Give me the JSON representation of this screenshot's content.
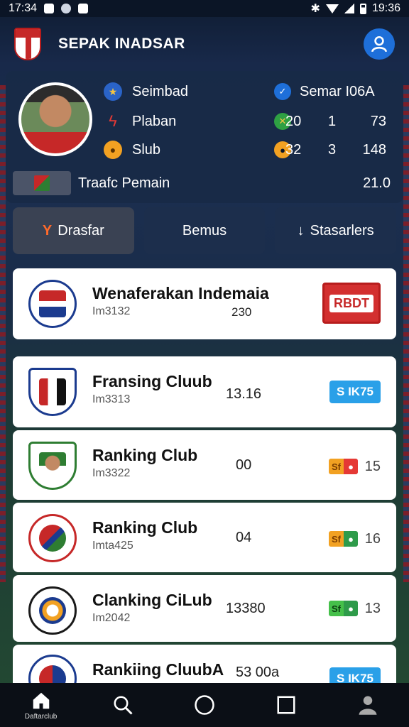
{
  "status_bar": {
    "time_left": "17:34",
    "time_right": "19:36"
  },
  "header": {
    "title": "SEPAK INADSAR",
    "profile_icon": "user-icon"
  },
  "player": {
    "rows": [
      {
        "label": "Seimbad",
        "icon_left": "trophy-icon",
        "icon_right": "checkmark-icon",
        "right_text": "Semar I06A"
      },
      {
        "label": "Plaban",
        "icon_left": "bolt-icon",
        "icon_right": "whistle-icon",
        "v1": "20",
        "v2": "1",
        "v3": "73"
      },
      {
        "label": "Slub",
        "icon_left": "medal-icon",
        "icon_right": "medal-icon",
        "v1": "32",
        "v2": "3",
        "v3": "148"
      }
    ],
    "sub_label": "Traafc Pemain",
    "sub_value": "21.0"
  },
  "tabs": [
    {
      "label": "Drasfar",
      "icon": "Y"
    },
    {
      "label": "Bemus",
      "icon": ""
    },
    {
      "label": "Stasarlers",
      "icon": "↓"
    }
  ],
  "clubs": [
    {
      "name": "Wenaferakan Indemaia",
      "code": "Im3132",
      "stat": "230",
      "badge": "RBDT",
      "badge_type": "big"
    },
    {
      "name": "Fransing Cluub",
      "code": "Im3313",
      "stat": "13.16",
      "badge": "S IK75",
      "badge_type": "pill"
    },
    {
      "name": "Ranking Club",
      "code": "Im3322",
      "stat": "00",
      "badge": "Sf",
      "badge_type": "mini",
      "mini_color": "#e53935",
      "rank": "15"
    },
    {
      "name": "Ranking Club",
      "code": "Imta425",
      "stat": "04",
      "badge": "Sf",
      "badge_type": "mini",
      "mini_color": "#2e9b4a",
      "rank": "16"
    },
    {
      "name": "Clanking CiLub",
      "code": "Im2042",
      "stat": "13380",
      "badge": "Sf",
      "badge_type": "mini",
      "mini_color": "#2e9b4a",
      "rank": "13"
    },
    {
      "name": "Rankiing CluubA",
      "code": "",
      "stat": "53 00a",
      "badge": "S IK75",
      "badge_type": "pill"
    }
  ],
  "bottom_nav": [
    {
      "icon": "home-icon",
      "label": "Daftarclub"
    },
    {
      "icon": "search-icon",
      "label": ""
    },
    {
      "icon": "circle-icon",
      "label": ""
    },
    {
      "icon": "square-icon",
      "label": ""
    },
    {
      "icon": "profile-icon",
      "label": ""
    }
  ]
}
